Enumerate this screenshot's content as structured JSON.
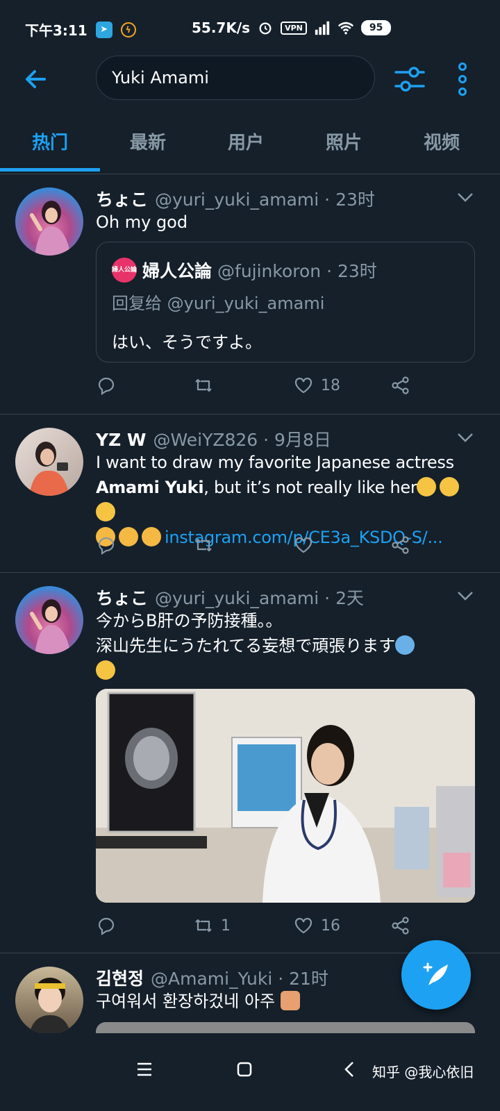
{
  "status_bar": {
    "time": "下午3:11",
    "speed": "55.7K/s",
    "vpn": "VPN",
    "battery": "95"
  },
  "search": {
    "query": "Yuki Amami"
  },
  "tabs": [
    {
      "label": "热门",
      "active": true
    },
    {
      "label": "最新",
      "active": false
    },
    {
      "label": "用户",
      "active": false
    },
    {
      "label": "照片",
      "active": false
    },
    {
      "label": "视频",
      "active": false
    }
  ],
  "tweets": [
    {
      "name": "ちょこ",
      "handle": "@yuri_yuki_amami · 23时",
      "text": "Oh my god",
      "quote": {
        "avatar_text": "婦人公論",
        "name": "婦人公論",
        "handle": "@fujinkoron · 23时",
        "reply_to": "回复给 @yuri_yuki_amami",
        "text": "はい、そうですよ。"
      },
      "actions": {
        "retweets": "",
        "likes": "18"
      }
    },
    {
      "name": "YZ W",
      "handle": "@WeiYZ826 · 9月8日",
      "text_pre": "I want to draw my favorite Japanese actress",
      "text_bold": "Amami Yuki",
      "text_post": ", but it’s not really like her",
      "link": "instagram.com/p/CE3a_KSDQ-S/...",
      "actions": {
        "retweets": "",
        "likes": ""
      }
    },
    {
      "name": "ちょこ",
      "handle": "@yuri_yuki_amami · 2天",
      "line1": "今からB肝の予防接種。。",
      "line2": "深山先生にうたれてる妄想で頑張ります",
      "actions": {
        "retweets": "1",
        "likes": "16"
      }
    },
    {
      "name": "김현정",
      "handle": "@Amami_Yuki · 21时",
      "text": "구여워서 환장하겄네 아주"
    }
  ],
  "watermark": "知乎 @我心依旧",
  "colors": {
    "background": "#15202b",
    "accent": "#1da1f2",
    "secondary_text": "#8899a6",
    "divider": "#38444d"
  },
  "icons": [
    "arrow-left-icon",
    "filter-icon",
    "more-vertical-icon",
    "chevron-down-icon",
    "reply-icon",
    "retweet-icon",
    "like-icon",
    "share-icon",
    "compose-icon"
  ]
}
